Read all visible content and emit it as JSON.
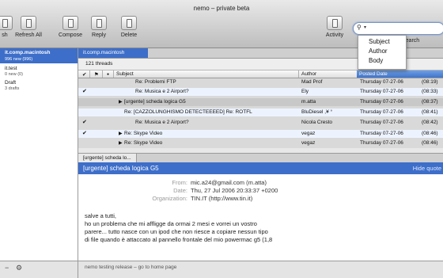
{
  "window": {
    "title": "nemo – private beta"
  },
  "toolbar": {
    "buttons": [
      {
        "label": "sh"
      },
      {
        "label": "Refresh All"
      },
      {
        "label": "Compose"
      },
      {
        "label": "Reply"
      },
      {
        "label": "Delete"
      },
      {
        "label": "Activity"
      }
    ],
    "search_label": "Search",
    "search_value": ""
  },
  "search_menu": {
    "options": [
      "Subject",
      "Author",
      "Body"
    ]
  },
  "sidebar": {
    "items": [
      {
        "name": "it.comp.macintosh",
        "sub": "996 new (996)"
      },
      {
        "name": "it.test",
        "sub": "0 new (0)"
      },
      {
        "name": "Draft",
        "sub": "3 drafts"
      }
    ],
    "footer": {
      "minus": "−",
      "gear": "⚙"
    }
  },
  "tabs": {
    "active": "it.comp.macintosh"
  },
  "threadlist": {
    "count": "121 threads",
    "columns": {
      "check": "✔",
      "flag": "⚑",
      "unread": "●",
      "subject": "Subject",
      "author": "Author",
      "date": "Posted Date"
    },
    "rows": [
      {
        "mark": "",
        "subject": "Re: Problemi FTP",
        "author": "Mad Prof",
        "date": "Thursday 07-27-06",
        "time": "(08:19)"
      },
      {
        "mark": "✔",
        "subject": "Re: Musica e 2 Airport?",
        "author": "Ely",
        "date": "Thursday 07-27-06",
        "time": "(08:33)"
      },
      {
        "mark": "",
        "subject": "[urgente] scheda logica G5",
        "author": "m.atta",
        "date": "Thursday 07-27-06",
        "time": "(08:37)"
      },
      {
        "mark": "",
        "subject": "Re: [CAZZOLUNGHISMO DETECTEEEED] Re: ROTFL",
        "author": "BluDiesel ,¥ °",
        "date": "Thursday 07-27-06",
        "time": "(08:41)"
      },
      {
        "mark": "✔",
        "subject": "Re: Musica e 2 Airport?",
        "author": "Nicola Cresto",
        "date": "Thursday 07-27-06",
        "time": "(08:42)"
      },
      {
        "mark": "✔",
        "subject": "Re: Skype Video",
        "author": "vegaz",
        "date": "Thursday 07-27-06",
        "time": "(08:46)"
      },
      {
        "mark": "",
        "subject": "Re: Skype Video",
        "author": "vegaz",
        "date": "Thursday 07-27-06",
        "time": "(08:46)"
      }
    ]
  },
  "preview": {
    "tab": "[urgente] scheda lo...",
    "subject": "[urgente] scheda logica G5",
    "hide_quote": "Hide quote",
    "headers": [
      {
        "key": "From:",
        "value": "mic.a24@gmail.com (m.atta)"
      },
      {
        "key": "Date:",
        "value": "Thu, 27 Jul 2006 20:33:37 +0200"
      },
      {
        "key": "Organization:",
        "value": "TIN.IT (http://www.tin.it)"
      }
    ],
    "body": [
      "salve a tutti,",
      "ho un problema che mi affligge da ormai 2 mesi e vorrei un vostro",
      "parere... tutto nasce con un ipod che non riesce a copiare nessun tipo",
      "di file quando è attaccato al pannello frontale del mio powermac g5 (1,8"
    ]
  },
  "status": {
    "text": "nemo testing release – go to home page"
  }
}
